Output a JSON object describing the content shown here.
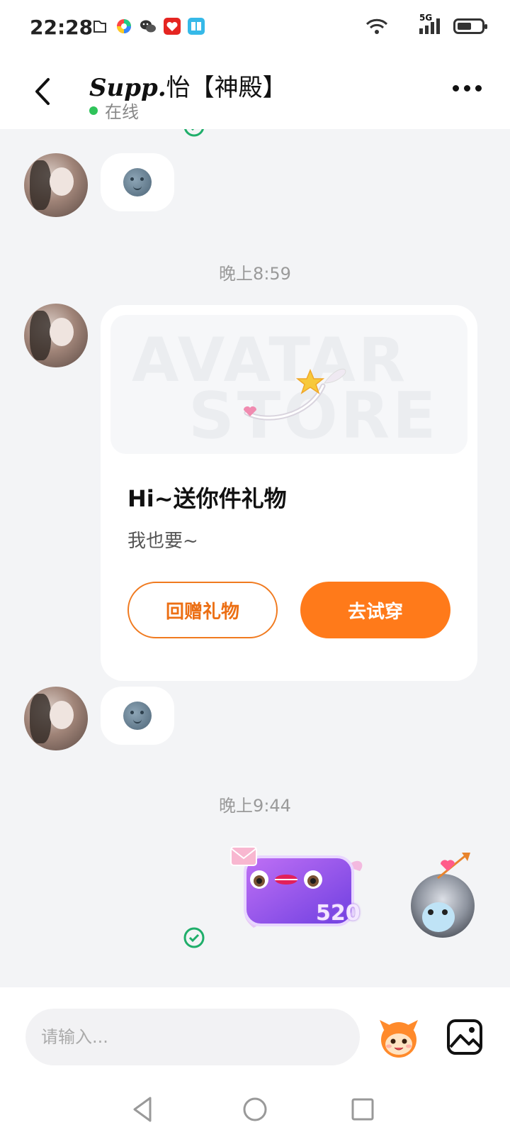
{
  "status_bar": {
    "time": "22:28",
    "network": "5G",
    "battery_level": 0.6,
    "app_icons": [
      "file-icon",
      "colorful-app-icon",
      "wechat-icon",
      "red-app-icon",
      "book-app-icon"
    ]
  },
  "header": {
    "contact_name_script": "Supp.",
    "contact_name": "怡【神殿】",
    "presence": "在线",
    "presence_color": "#2fc35a"
  },
  "messages": {
    "timestamp_1": "晚上8:59",
    "timestamp_2": "晚上9:44",
    "emoji_1": "moon-face-emoji",
    "emoji_2": "moon-face-emoji",
    "sticker_label": "520"
  },
  "gift_card": {
    "banner_line1": "AVATAR",
    "banner_line2": "STORE",
    "title": "Hi~送你件礼物",
    "subtitle": "我也要~",
    "return_gift_label": "回赠礼物",
    "try_on_label": "去试穿",
    "accent_color": "#ff7a1a"
  },
  "input_bar": {
    "placeholder": "请输入..."
  },
  "colors": {
    "background": "#f3f4f6",
    "read_check": "#1fae6a"
  }
}
